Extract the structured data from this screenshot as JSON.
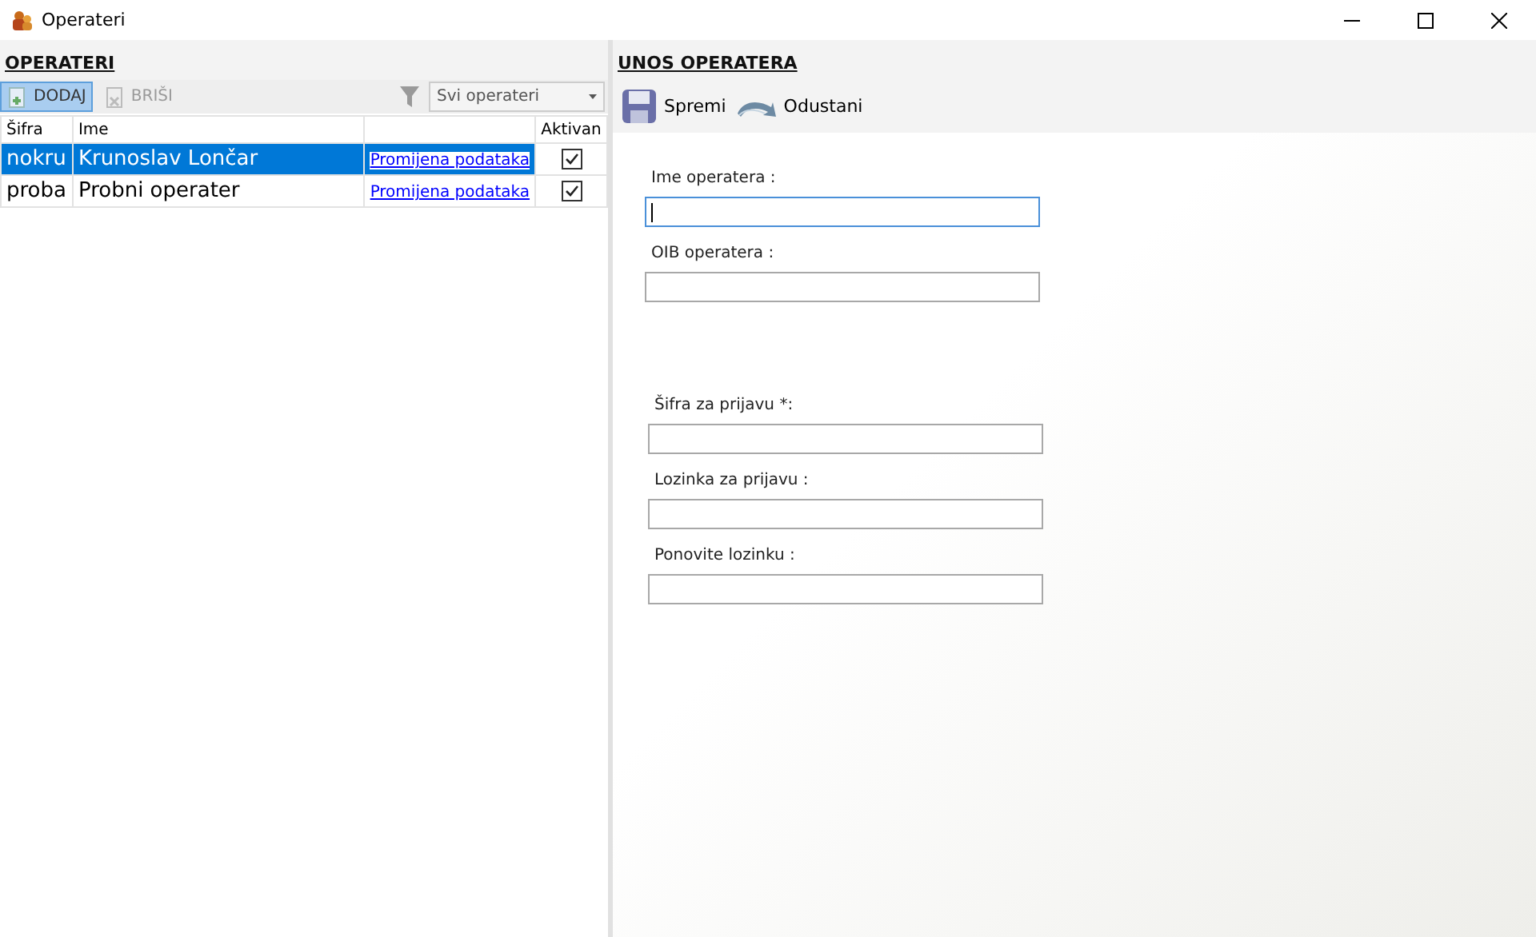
{
  "window": {
    "title": "Operateri"
  },
  "left_panel": {
    "title": "OPERATERI",
    "toolbar": [
      {
        "label": "DODAJ",
        "highlighted": true,
        "disabled": false
      },
      {
        "label": "BRIŠI",
        "highlighted": false,
        "disabled": true
      }
    ],
    "filter": {
      "value": "Svi operateri"
    },
    "table": {
      "columns": {
        "sifra": "Šifra",
        "ime": "Ime",
        "aktivan": "Aktivan"
      },
      "rows": [
        {
          "sifra": "nokru",
          "ime": "Krunoslav Lončar",
          "link": "Promijena podataka",
          "aktivan": true,
          "selected": true
        },
        {
          "sifra": "proba",
          "ime": "Probni operater",
          "link": "Promijena podataka",
          "aktivan": true,
          "selected": false
        }
      ]
    }
  },
  "right_panel": {
    "title": "UNOS OPERATERA",
    "toolbar": [
      {
        "label": "Spremi"
      },
      {
        "label": "Odustani"
      }
    ],
    "field_groups": [
      [
        {
          "label": "Ime operatera :",
          "focused": true
        },
        {
          "label": "OIB operatera :",
          "focused": false
        }
      ],
      [
        {
          "label": "Šifra za prijavu *:",
          "focused": false
        },
        {
          "label": "Lozinka za prijavu :",
          "focused": false
        },
        {
          "label": "Ponovite lozinku :",
          "focused": false
        }
      ]
    ]
  }
}
